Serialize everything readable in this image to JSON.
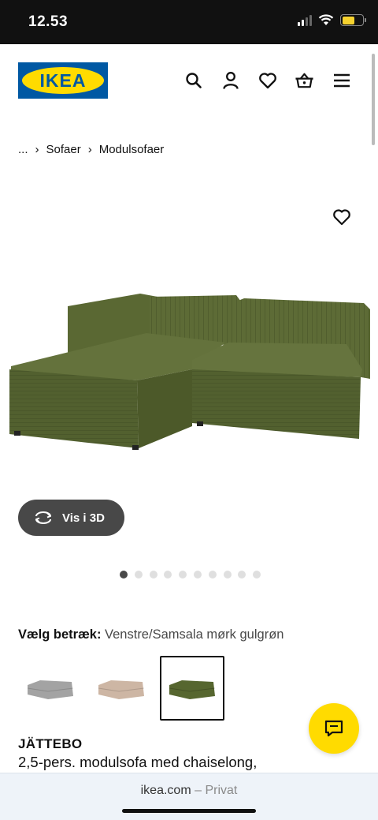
{
  "status_bar": {
    "time": "12.53",
    "battery_level": 0.6
  },
  "header": {
    "logo_text": "IKEA",
    "brand_colors": {
      "blue": "#0058a3",
      "yellow": "#ffdb00"
    },
    "icons": [
      "search-icon",
      "user-icon",
      "heart-icon",
      "basket-icon",
      "menu-icon"
    ]
  },
  "breadcrumb": {
    "ellipsis": "...",
    "items": [
      "Sofaer",
      "Modulsofaer"
    ]
  },
  "gallery": {
    "image_count": 10,
    "active_index": 0,
    "view3d_label": "Vis i 3D",
    "product_color": "#5d6b36"
  },
  "cover": {
    "label": "Vælg betræk:",
    "value": "Venstre/Samsala mørk gulgrøn",
    "options": [
      {
        "color": "#a3a3a3",
        "selected": false
      },
      {
        "color": "#cdb6a4",
        "selected": false
      },
      {
        "color": "#56662f",
        "selected": true
      }
    ]
  },
  "product": {
    "name": "JÄTTEBO",
    "description": "2,5-pers. modulsofa med chaiselong,"
  },
  "browser": {
    "domain": "ikea.com",
    "mode": "– Privat"
  }
}
